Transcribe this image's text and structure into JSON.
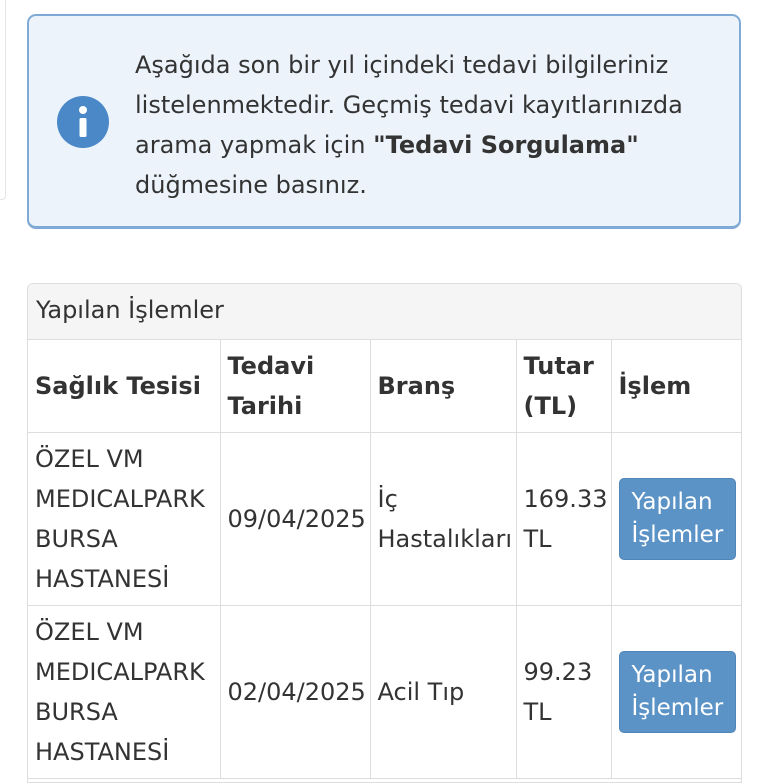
{
  "info": {
    "line1": "Aşağıda son bir yıl içindeki tedavi bilgileriniz",
    "line2": "listelenmektedir. Geçmiş tedavi kayıtlarınızda",
    "line3_pre": "arama yapmak için ",
    "line3_bold": "\"Tedavi Sorgulama\"",
    "line4": "düğmesine basınız.",
    "icon": "info-icon",
    "icon_color": "#4a88c8"
  },
  "panel": {
    "title": "Yapılan İşlemler",
    "columns": {
      "facility": "Sağlık Tesisi",
      "date_l1": "Tedavi",
      "date_l2": "Tarihi",
      "branch": "Branş",
      "amount_l1": "Tutar",
      "amount_l2": "(TL)",
      "action": "İşlem"
    },
    "rows": [
      {
        "facility": [
          "ÖZEL VM",
          "MEDICALPARK",
          "BURSA",
          "HASTANESİ"
        ],
        "date": "09/04/2025",
        "branch": [
          "İç",
          "Hastalıkları"
        ],
        "amount": [
          "169.33",
          "TL"
        ],
        "button": [
          "Yapılan",
          "İşlemler"
        ]
      },
      {
        "facility": [
          "ÖZEL VM",
          "MEDICALPARK",
          "BURSA",
          "HASTANESİ"
        ],
        "date": "02/04/2025",
        "branch": [
          "Acil Tıp"
        ],
        "amount": [
          "99.23",
          "TL"
        ],
        "button": [
          "Yapılan",
          "İşlemler"
        ]
      }
    ]
  },
  "colors": {
    "accent": "#5b93c7",
    "info_bg": "#ecf3fa",
    "info_border": "#7fa9d6"
  }
}
